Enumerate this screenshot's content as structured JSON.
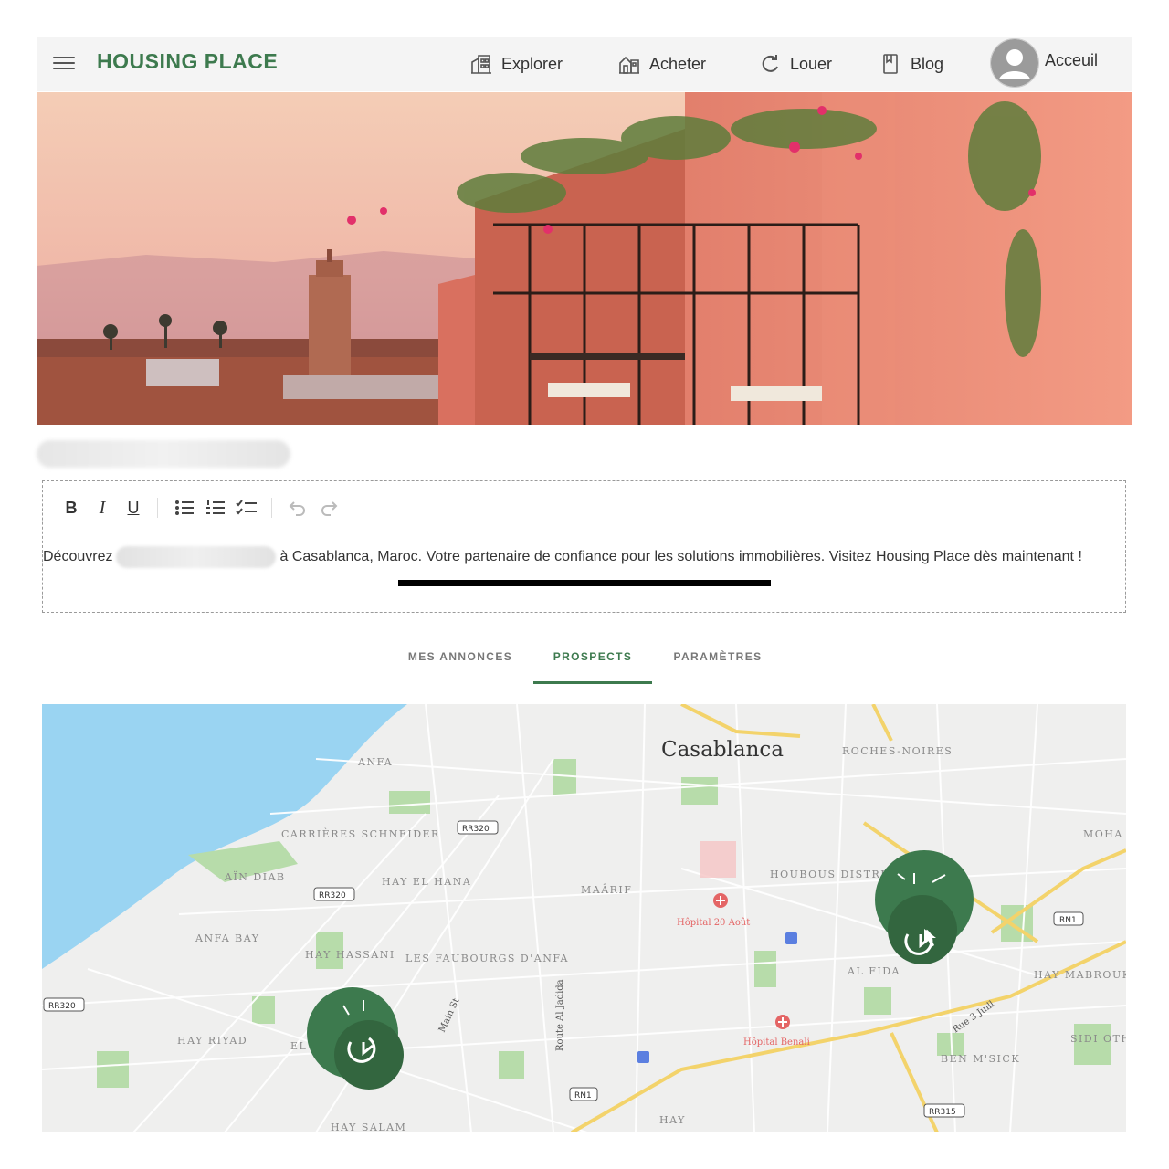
{
  "header": {
    "logo": "HOUSING PLACE",
    "nav": [
      {
        "label": "Explorer",
        "icon": "building-icon"
      },
      {
        "label": "Acheter",
        "icon": "house-icon"
      },
      {
        "label": "Louer",
        "icon": "refresh-icon"
      },
      {
        "label": "Blog",
        "icon": "bookmark-icon"
      }
    ],
    "account_label": "Acceuil"
  },
  "editor": {
    "toolbar": [
      "bold",
      "italic",
      "underline",
      "bullet-list",
      "numbered-list",
      "check-list",
      "undo",
      "redo"
    ],
    "bold_label": "B",
    "italic_label": "I",
    "underline_label": "U",
    "text_before": "Découvrez",
    "text_after": "à Casablanca, Maroc. Votre partenaire de confiance pour les solutions immobilières. Visitez Housing Place dès maintenant !"
  },
  "tabs": [
    {
      "label": "MES ANNONCES",
      "active": false
    },
    {
      "label": "PROSPECTS",
      "active": true
    },
    {
      "label": "PARAMÈTRES",
      "active": false
    }
  ],
  "map": {
    "city": "Casablanca",
    "districts": [
      "ANFA",
      "ROCHES-NOIRES",
      "CARRIÈRES SCHNEIDER",
      "AÏN DIAB",
      "HAY EL HANA",
      "MAÂRIF",
      "HOUBOUS DISTRICT",
      "ANFA BAY",
      "HAY HASSANI",
      "LES FAUBOURGS D'ANFA",
      "AL FIDA",
      "HAY MABROUKA",
      "HAY RIYAD",
      "BEN M'SICK",
      "SIDI OTHMANE",
      "HAY SALAM",
      "MOHA",
      "EL",
      "HAY"
    ],
    "roads": [
      "Route Al Jadida",
      "Rue 3 Juill",
      "Main St"
    ],
    "road_shields": [
      "RR320",
      "RR320",
      "RN1",
      "RR320",
      "RN1",
      "RR315"
    ],
    "hospitals": [
      "Hôpital 20 Août",
      "Hôpital Benali"
    ],
    "markers": 2,
    "colors": {
      "water": "#9ad4f2",
      "land": "#efefee",
      "park": "#b7dcaa",
      "major_road": "#f3d36b",
      "marker": "#3d7a4e"
    }
  },
  "colors": {
    "brand": "#3d7a4e",
    "header_bg": "#f4f4f4",
    "text": "#333333"
  }
}
